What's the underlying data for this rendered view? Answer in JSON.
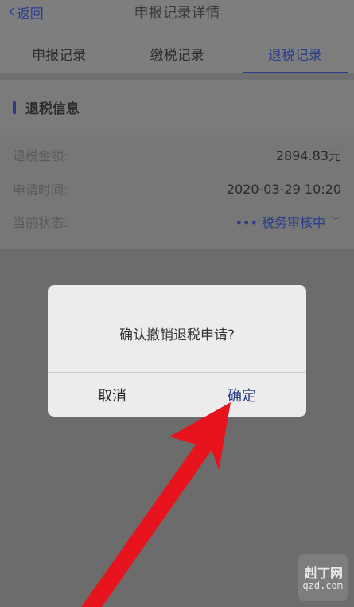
{
  "header": {
    "back_label": "返回",
    "title": "申报记录详情"
  },
  "tabs": [
    {
      "label": "申报记录",
      "active": false
    },
    {
      "label": "缴税记录",
      "active": false
    },
    {
      "label": "退税记录",
      "active": true
    }
  ],
  "section": {
    "title": "退税信息"
  },
  "info": {
    "refund_amount_label": "退税金额:",
    "refund_amount_value": "2894.83元",
    "apply_time_label": "申请时间:",
    "apply_time_value": "2020-03-29 10:20",
    "status_label": "当前状态:",
    "status_value": "••• 税务审核中"
  },
  "dialog": {
    "message": "确认撤销退税申请?",
    "cancel_label": "取消",
    "confirm_label": "确定"
  },
  "watermark": {
    "line1": "赳丁网",
    "line2": "qzd.com"
  },
  "colors": {
    "accent": "#2a3d8c",
    "arrow": "#e8141d",
    "overlay": "#6f6f6f"
  },
  "icons": {
    "back": "chevron-left-icon",
    "status_chevron": "chevron-down-icon",
    "arrow": "red-arrow-icon"
  }
}
